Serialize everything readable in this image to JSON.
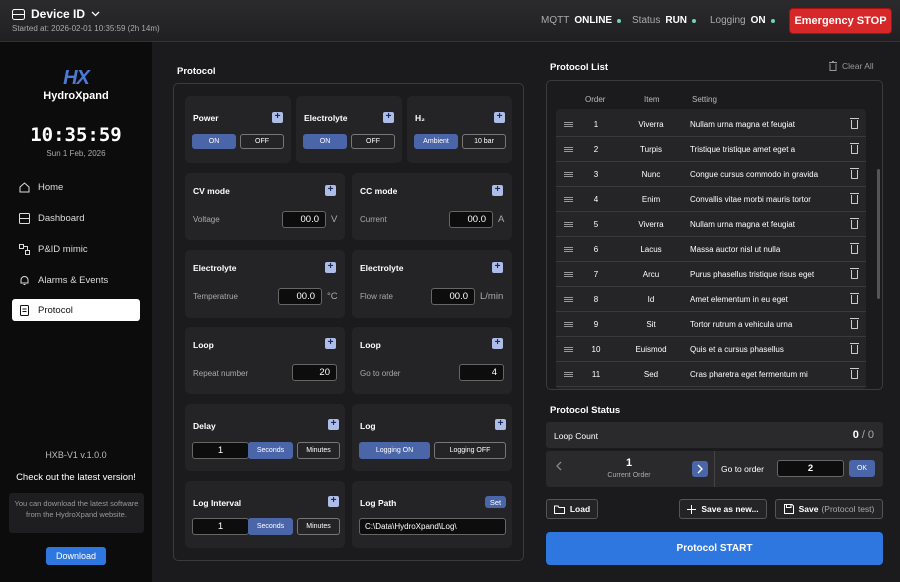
{
  "header": {
    "device": "Device ID",
    "started": "Started at: 2026-02-01 10:35:59 (2h 14m)",
    "mqtt_label": "MQTT",
    "mqtt_value": "ONLINE",
    "status_label": "Status",
    "status_value": "RUN",
    "logging_label": "Logging",
    "logging_value": "ON",
    "estop": "Emergency STOP"
  },
  "sidebar": {
    "logo_mark": "HX",
    "logo_name": "HydroXpand",
    "clock": "10:35:59",
    "date": "Sun 1 Feb, 2026",
    "items": [
      {
        "label": "Home",
        "icon": "home-icon"
      },
      {
        "label": "Dashboard",
        "icon": "dashboard-icon"
      },
      {
        "label": "P&ID mimic",
        "icon": "pid-icon"
      },
      {
        "label": "Alarms & Events",
        "icon": "bell-icon"
      },
      {
        "label": "Protocol",
        "icon": "protocol-icon"
      }
    ],
    "version": "HXB-V1 v.1.0.0",
    "checkout": "Check out the latest version!",
    "note": "You can download the latest software from the HydroXpand website.",
    "download": "Download"
  },
  "protocol": {
    "title": "Protocol",
    "power": {
      "title": "Power",
      "on": "ON",
      "off": "OFF"
    },
    "electrolyte": {
      "title": "Electrolyte",
      "on": "ON",
      "off": "OFF"
    },
    "h2": {
      "title": "H₂",
      "a": "Ambient",
      "b": "10 bar"
    },
    "cv": {
      "title": "CV mode",
      "label": "Voltage",
      "value": "00.0",
      "unit": "V"
    },
    "cc": {
      "title": "CC mode",
      "label": "Current",
      "value": "00.0",
      "unit": "A"
    },
    "temp": {
      "title": "Electrolyte",
      "label": "Temperatrue",
      "value": "00.0",
      "unit": "°C"
    },
    "flow": {
      "title": "Electrolyte",
      "label": "Flow rate",
      "value": "00.0",
      "unit": "L/min"
    },
    "loop1": {
      "title": "Loop",
      "label": "Repeat number",
      "value": "20"
    },
    "loop2": {
      "title": "Loop",
      "label": "Go to order",
      "value": "4"
    },
    "delay": {
      "title": "Delay",
      "value": "1",
      "a": "Seconds",
      "b": "Minutes"
    },
    "log": {
      "title": "Log",
      "a": "Logging ON",
      "b": "Logging OFF"
    },
    "interval": {
      "title": "Log Interval",
      "value": "1",
      "a": "Seconds",
      "b": "Minutes"
    },
    "path": {
      "title": "Log Path",
      "set": "Set",
      "value": "C:\\Data\\HydroXpand\\Log\\"
    }
  },
  "list": {
    "title": "Protocol List",
    "clear": "Clear All",
    "cols": [
      "Order",
      "Item",
      "Setting"
    ],
    "rows": [
      [
        "1",
        "Viverra",
        "Nullam urna magna et feugiat"
      ],
      [
        "2",
        "Turpis",
        "Tristique tristique amet eget a"
      ],
      [
        "3",
        "Nunc",
        "Congue cursus commodo in gravida"
      ],
      [
        "4",
        "Enim",
        "Convallis vitae morbi mauris tortor"
      ],
      [
        "5",
        "Viverra",
        "Nullam urna magna et feugiat"
      ],
      [
        "6",
        "Lacus",
        "Massa auctor nisl ut nulla"
      ],
      [
        "7",
        "Arcu",
        "Purus phasellus tristique risus eget"
      ],
      [
        "8",
        "Id",
        "Amet elementum in eu eget"
      ],
      [
        "9",
        "Sit",
        "Tortor rutrum a vehicula urna"
      ],
      [
        "10",
        "Euismod",
        "Quis et a cursus phasellus"
      ],
      [
        "11",
        "Sed",
        "Cras pharetra eget fermentum mi"
      ]
    ]
  },
  "status": {
    "title": "Protocol Status",
    "loop_label": "Loop Count",
    "loop_cur": "0",
    "loop_sep": "/",
    "loop_total": "0",
    "current": "1",
    "current_label": "Current Order",
    "goto_label": "Go to order",
    "goto_value": "2",
    "ok": "OK",
    "load": "Load",
    "save_new": "Save as new...",
    "save": "Save",
    "save_note": "(Protocol test)",
    "start": "Protocol START"
  }
}
